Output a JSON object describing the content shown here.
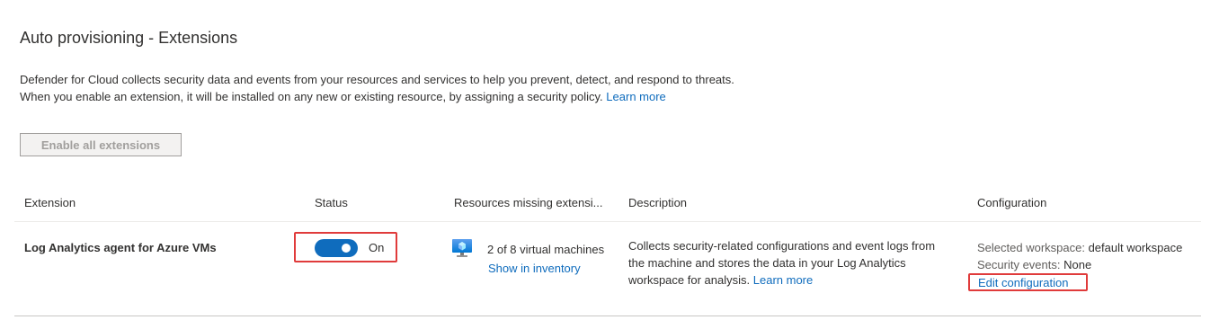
{
  "page": {
    "title": "Auto provisioning - Extensions",
    "intro_line1": "Defender for Cloud collects security data and events from your resources and services to help you prevent, detect, and respond to threats.",
    "intro_line2": "When you enable an extension, it will be installed on any new or existing resource, by assigning a security policy.",
    "learn_more": "Learn more",
    "enable_all_label": "Enable all extensions"
  },
  "table": {
    "headers": {
      "extension": "Extension",
      "status": "Status",
      "resources": "Resources missing extensi...",
      "description": "Description",
      "configuration": "Configuration"
    },
    "rows": [
      {
        "extension": "Log Analytics agent for Azure VMs",
        "status_label": "On",
        "status_on": true,
        "resources_count": "2 of 8 virtual machines",
        "resources_link": "Show in inventory",
        "description_line1": "Collects security-related configurations and event logs from",
        "description_line2": "the machine and stores the data in your Log Analytics",
        "description_line3": "workspace for analysis.",
        "description_link": "Learn more",
        "workspace_label": "Selected workspace:",
        "workspace_value": "default workspace",
        "events_label": "Security events:",
        "events_value": "None",
        "edit_link": "Edit configuration"
      }
    ]
  },
  "colors": {
    "link": "#0f6cbd",
    "toggle_on": "#0f6cbd",
    "highlight_border": "#e03b3b"
  },
  "icons": {
    "resource_icon": "virtual-machine-icon"
  }
}
